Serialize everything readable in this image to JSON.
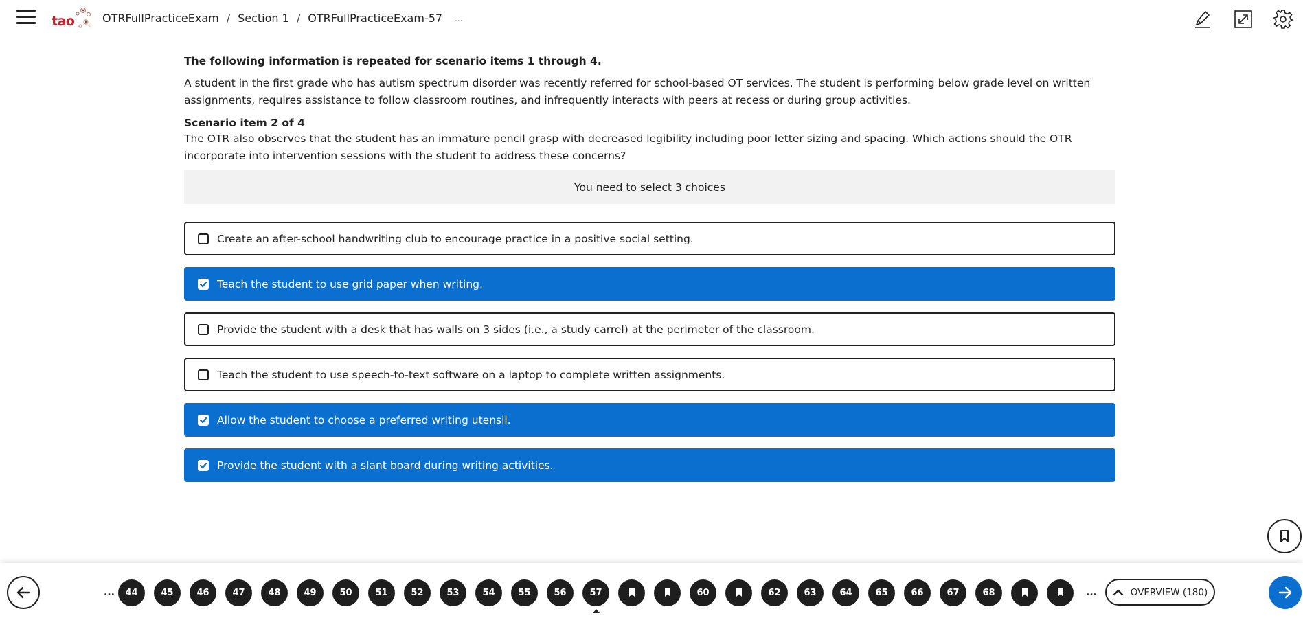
{
  "header": {
    "logo_text": "tao",
    "breadcrumb": [
      "OTRFullPracticeExam",
      "Section 1",
      "OTRFullPracticeExam-57"
    ],
    "breadcrumb_more": "...",
    "icons": [
      "menu-icon",
      "pencil-icon",
      "fullscreen-icon",
      "gear-icon"
    ]
  },
  "passage": {
    "heading": "The following information is repeated for scenario items 1 through 4.",
    "text": "A student in the first grade who has autism spectrum disorder was recently referred for school-based OT services. The student is performing below grade level on written assignments, requires assistance to follow classroom routines, and infrequently interacts with peers at recess or during group activities."
  },
  "question": {
    "scenario_label": "Scenario item 2 of 4",
    "prompt": "The OTR also observes that the student has an immature pencil grasp with decreased legibility including poor letter sizing and spacing. Which actions should the OTR incorporate into intervention sessions with the student to address these concerns?",
    "instruction": "You need to select 3 choices",
    "choices": [
      {
        "label": "Create an after-school handwriting club to encourage practice in a positive social setting.",
        "selected": false
      },
      {
        "label": "Teach the student to use grid paper when writing.",
        "selected": true
      },
      {
        "label": "Provide the student with a desk that has walls on 3 sides (i.e., a study carrel) at the perimeter of the classroom.",
        "selected": false
      },
      {
        "label": "Teach the student to use speech-to-text software on a laptop to complete written assignments.",
        "selected": false
      },
      {
        "label": "Allow the student to choose a preferred writing utensil.",
        "selected": true
      },
      {
        "label": "Provide the student with a slant board during writing activities.",
        "selected": true
      }
    ]
  },
  "navigation": {
    "ellipsis": "...",
    "items": [
      {
        "label": "44"
      },
      {
        "label": "45"
      },
      {
        "label": "46"
      },
      {
        "label": "47"
      },
      {
        "label": "48"
      },
      {
        "label": "49"
      },
      {
        "label": "50"
      },
      {
        "label": "51"
      },
      {
        "label": "52"
      },
      {
        "label": "53"
      },
      {
        "label": "54"
      },
      {
        "label": "55"
      },
      {
        "label": "56"
      },
      {
        "label": "57",
        "current": true
      },
      {
        "label": "",
        "bookmarked": true
      },
      {
        "label": "",
        "bookmarked": true
      },
      {
        "label": "60"
      },
      {
        "label": "",
        "bookmarked": true
      },
      {
        "label": "62"
      },
      {
        "label": "63"
      },
      {
        "label": "64"
      },
      {
        "label": "65"
      },
      {
        "label": "66"
      },
      {
        "label": "67"
      },
      {
        "label": "68"
      },
      {
        "label": "",
        "bookmarked": true
      },
      {
        "label": "",
        "bookmarked": true
      }
    ],
    "overview_label": "OVERVIEW (180)"
  },
  "colors": {
    "accent": "#0a6fcf",
    "nav_item": "#1e1e1e",
    "logo": "#c0262d"
  }
}
